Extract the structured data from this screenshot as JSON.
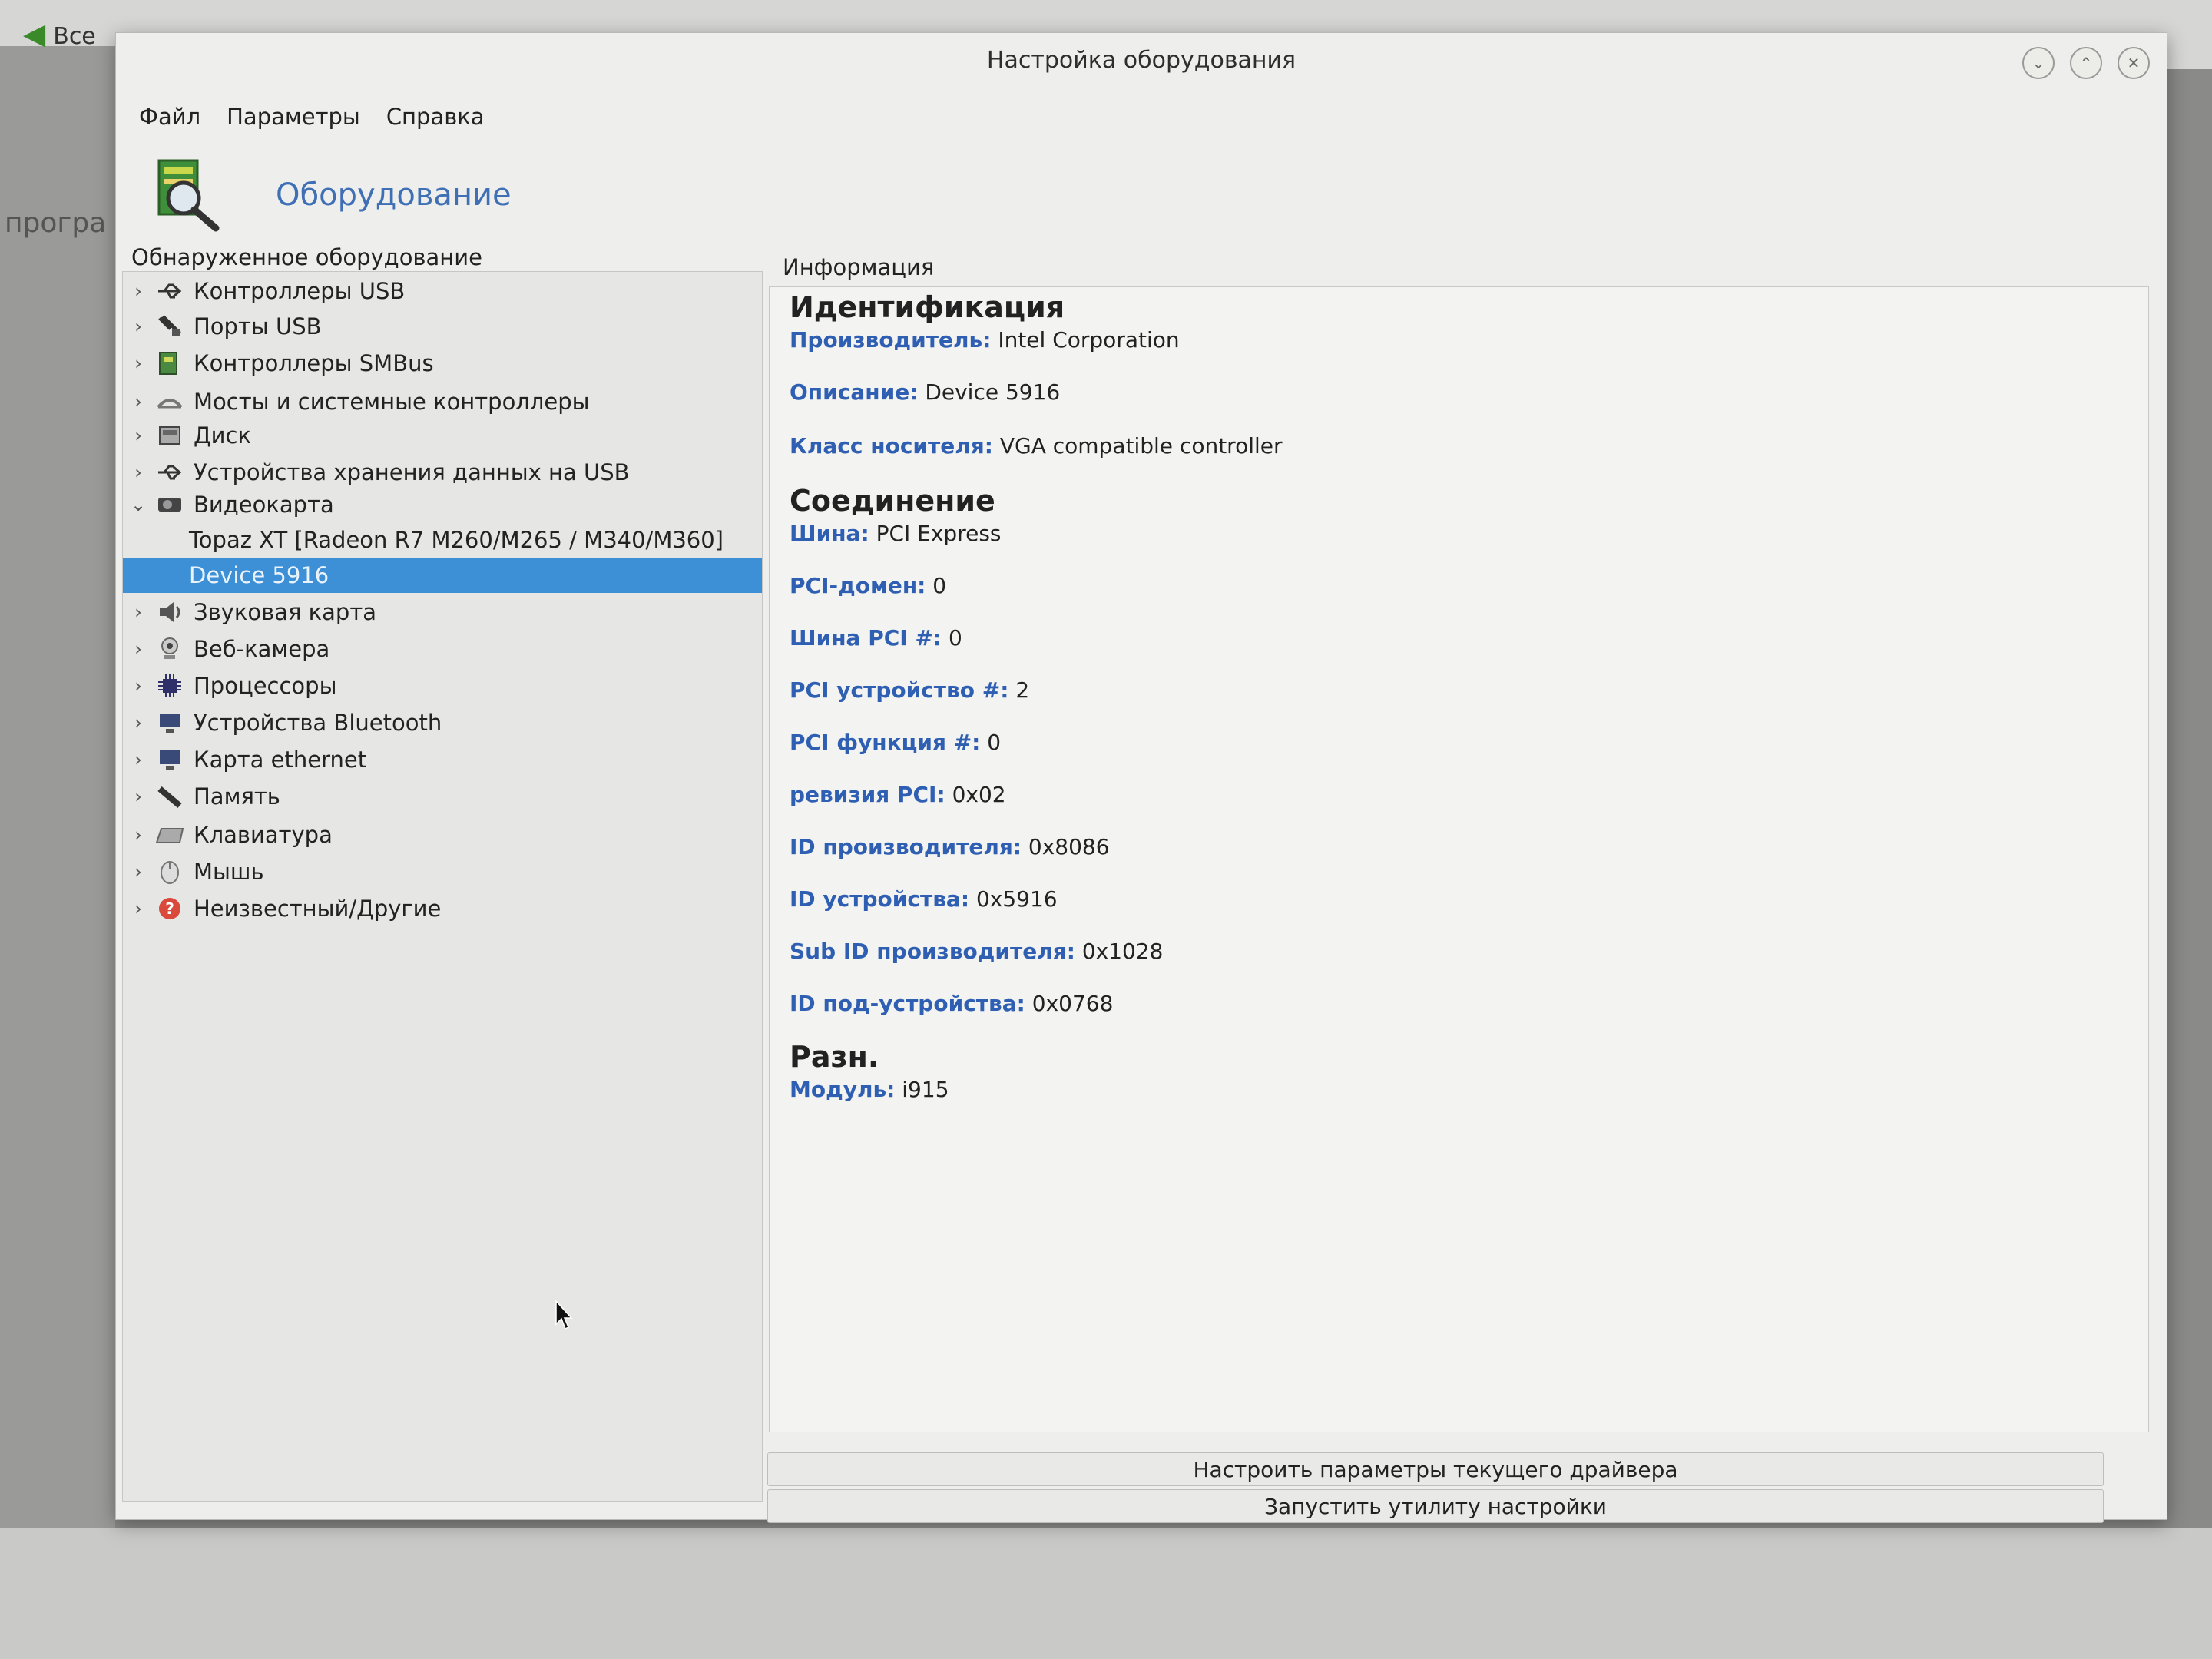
{
  "background": {
    "back_label": "Все",
    "side_text": "програ"
  },
  "window": {
    "title": "Настройка оборудования"
  },
  "menu": {
    "file": "Файл",
    "params": "Параметры",
    "help": "Справка"
  },
  "header": {
    "title": "Оборудование"
  },
  "left_panel": {
    "label": "Обнаруженное оборудование",
    "items": [
      {
        "label": "Контроллеры USB",
        "icon": "usb-icon",
        "expander": "›"
      },
      {
        "label": "Порты USB",
        "icon": "usb-plug-icon",
        "expander": "›"
      },
      {
        "label": "Контроллеры SMBus",
        "icon": "chip-icon",
        "expander": "›"
      },
      {
        "label": "Мосты и системные контроллеры",
        "icon": "bridge-icon",
        "expander": "›"
      },
      {
        "label": "Диск",
        "icon": "disk-icon",
        "expander": "›"
      },
      {
        "label": "Устройства хранения данных на USB",
        "icon": "usb-storage-icon",
        "expander": "›"
      },
      {
        "label": "Видеокарта",
        "icon": "video-card-icon",
        "expander": "⌄"
      },
      {
        "label": "Topaz XT [Radeon R7 M260/M265 / M340/M360]",
        "icon": "",
        "expander": ""
      },
      {
        "label": "Device 5916",
        "icon": "",
        "expander": ""
      },
      {
        "label": "Звуковая карта",
        "icon": "speaker-icon",
        "expander": "›"
      },
      {
        "label": "Веб-камера",
        "icon": "webcam-icon",
        "expander": "›"
      },
      {
        "label": "Процессоры",
        "icon": "cpu-icon",
        "expander": "›"
      },
      {
        "label": "Устройства Bluetooth",
        "icon": "bluetooth-device-icon",
        "expander": "›"
      },
      {
        "label": "Карта ethernet",
        "icon": "network-card-icon",
        "expander": "›"
      },
      {
        "label": "Память",
        "icon": "memory-icon",
        "expander": "›"
      },
      {
        "label": "Клавиатура",
        "icon": "keyboard-icon",
        "expander": "›"
      },
      {
        "label": "Мышь",
        "icon": "mouse-icon",
        "expander": "›"
      },
      {
        "label": "Неизвестный/Другие",
        "icon": "unknown-device-icon",
        "expander": "›"
      }
    ]
  },
  "info": {
    "label": "Информация",
    "identification": {
      "title": "Идентификация",
      "fields": [
        {
          "k": "Производитель:",
          "v": "Intel Corporation"
        },
        {
          "k": "Описание:",
          "v": "Device 5916"
        },
        {
          "k": "Класс носителя:",
          "v": "VGA compatible controller"
        }
      ]
    },
    "connection": {
      "title": "Соединение",
      "fields": [
        {
          "k": "Шина:",
          "v": "PCI Express"
        },
        {
          "k": "PCI-домен:",
          "v": "0"
        },
        {
          "k": "Шина PCI #:",
          "v": "0"
        },
        {
          "k": "PCI устройство #:",
          "v": "2"
        },
        {
          "k": "PCI функция #:",
          "v": "0"
        },
        {
          "k": "ревизия PCI:",
          "v": "0x02"
        },
        {
          "k": "ID производителя:",
          "v": "0x8086"
        },
        {
          "k": "ID устройства:",
          "v": "0x5916"
        },
        {
          "k": "Sub ID производителя:",
          "v": "0x1028"
        },
        {
          "k": "ID под-устройства:",
          "v": "0x0768"
        }
      ]
    },
    "misc": {
      "title": "Разн.",
      "fields": [
        {
          "k": "Модуль:",
          "v": "i915"
        }
      ]
    }
  },
  "buttons": {
    "configure_driver": "Настроить параметры текущего драйвера",
    "run_utility": "Запустить утилиту настройки"
  }
}
